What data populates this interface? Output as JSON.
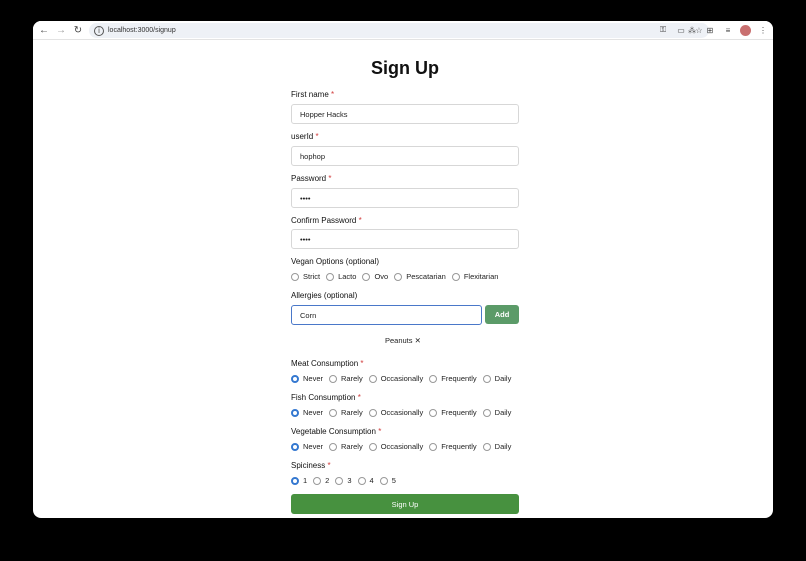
{
  "browser": {
    "url": "localhost:3000/signup"
  },
  "form": {
    "title": "Sign Up",
    "first_name": {
      "label": "First name",
      "value": "Hopper Hacks"
    },
    "user_id": {
      "label": "userId",
      "value": "hophop"
    },
    "password": {
      "label": "Password",
      "value": "••••"
    },
    "confirm_password": {
      "label": "Confirm Password",
      "value": "••••"
    },
    "vegan": {
      "label": "Vegan Options (optional)",
      "options": [
        "Strict",
        "Lacto",
        "Ovo",
        "Pescatarian",
        "Flexitarian"
      ]
    },
    "allergies": {
      "label": "Allergies (optional)",
      "value": "Corn",
      "add_label": "Add",
      "tags": [
        "Peanuts ✕"
      ]
    },
    "meat": {
      "label": "Meat Consumption",
      "options": [
        "Never",
        "Rarely",
        "Occasionally",
        "Frequently",
        "Daily"
      ],
      "selected": "Never"
    },
    "fish": {
      "label": "Fish Consumption",
      "options": [
        "Never",
        "Rarely",
        "Occasionally",
        "Frequently",
        "Daily"
      ],
      "selected": "Never"
    },
    "vegetable": {
      "label": "Vegetable Consumption",
      "options": [
        "Never",
        "Rarely",
        "Occasionally",
        "Frequently",
        "Daily"
      ],
      "selected": "Never"
    },
    "spiciness": {
      "label": "Spiciness",
      "options": [
        "1",
        "2",
        "3",
        "4",
        "5"
      ],
      "selected": "1"
    },
    "submit_label": "Sign Up",
    "required_mark": "*"
  },
  "colors": {
    "accent": "#3478d0",
    "submit": "#47913f",
    "add": "#5b9b68",
    "required": "#d13c3c"
  }
}
